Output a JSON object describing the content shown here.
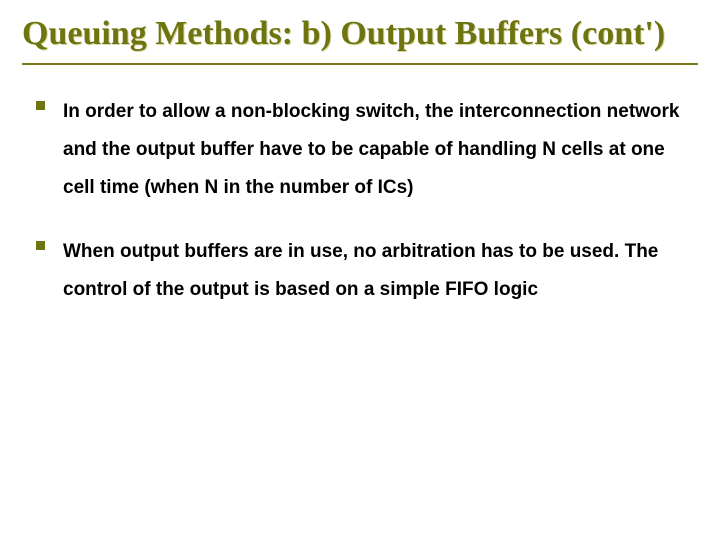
{
  "title": "Queuing Methods: b) Output Buffers (cont')",
  "bullets": [
    "In order to allow a non-blocking switch, the interconnection network and the output buffer have to be capable of handling N cells at one cell time (when N in the number of ICs)",
    "When output buffers are in use, no arbitration has to be used. The control of the output is based on a simple FIFO logic"
  ]
}
